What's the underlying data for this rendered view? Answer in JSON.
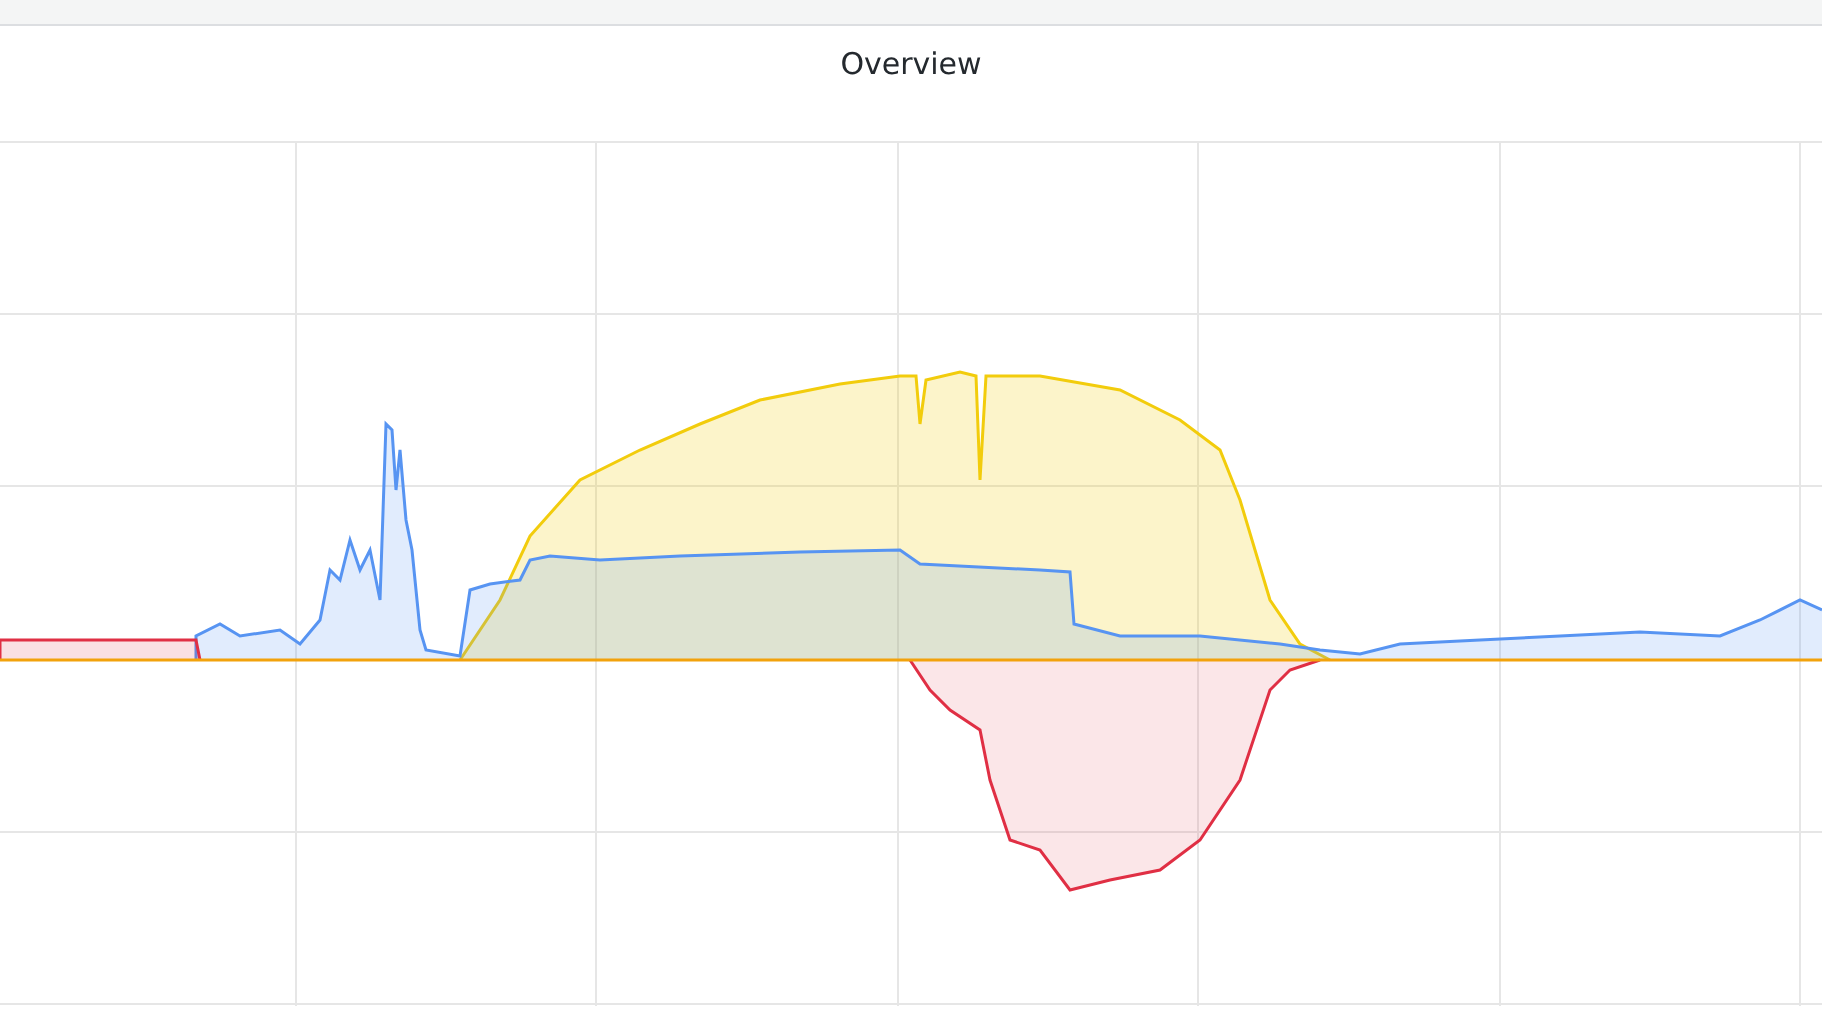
{
  "panel": {
    "title": "Overview"
  }
}
